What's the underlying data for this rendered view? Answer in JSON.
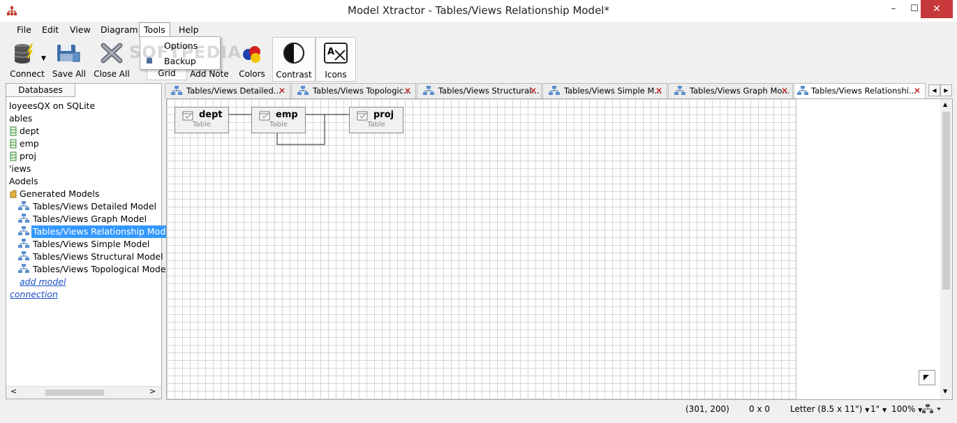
{
  "window": {
    "title": "Model Xtractor - Tables/Views Relationship Model*",
    "minimize": "–",
    "maximize": "☐",
    "close": "✕"
  },
  "menu": [
    "File",
    "Edit",
    "View",
    "Diagram",
    "Tools",
    "Help"
  ],
  "tools_menu": {
    "items": [
      "Options",
      "Backup"
    ]
  },
  "watermark": "SOFTPEDIA",
  "toolbar": {
    "connect": "Connect",
    "save_all": "Save All",
    "close_all": "Close All",
    "grid": "Grid",
    "add_note": "Add Note",
    "colors": "Colors",
    "contrast": "Contrast",
    "icons": "Icons"
  },
  "left_panel": {
    "tab": "Databases",
    "connection": "loyeesQX on SQLite",
    "tables_folder": "ables",
    "tables": [
      "dept",
      "emp",
      "proj"
    ],
    "views_folder": "'iews",
    "models_folder": "Aodels",
    "generated_models": "Generated Models",
    "models": [
      "Tables/Views Detailed Model",
      "Tables/Views Graph Model",
      "Tables/Views Relationship Model",
      "Tables/Views Simple Model",
      "Tables/Views Structural Model",
      "Tables/Views Topological Model"
    ],
    "add_model": "add model",
    "add_connection": "connection"
  },
  "doc_tabs": [
    {
      "label": "Tables/Views Detailed..."
    },
    {
      "label": "Tables/Views Topologic..."
    },
    {
      "label": "Tables/Views Structural..."
    },
    {
      "label": "Tables/Views Simple M..."
    },
    {
      "label": "Tables/Views Graph Mo..."
    },
    {
      "label": "Tables/Views Relationshi..."
    }
  ],
  "diagram": {
    "nodes": [
      {
        "name": "dept",
        "type": "Table"
      },
      {
        "name": "emp",
        "type": "Table"
      },
      {
        "name": "proj",
        "type": "Table"
      }
    ]
  },
  "status": {
    "coords": "(301, 200)",
    "size": "0 x 0",
    "paper": "Letter (8.5 x 11\")",
    "page": "1\"",
    "zoom": "100%"
  },
  "colors": {
    "selection": "#3399ff",
    "close_red": "#c7383b",
    "tab_close": "#c00000"
  }
}
